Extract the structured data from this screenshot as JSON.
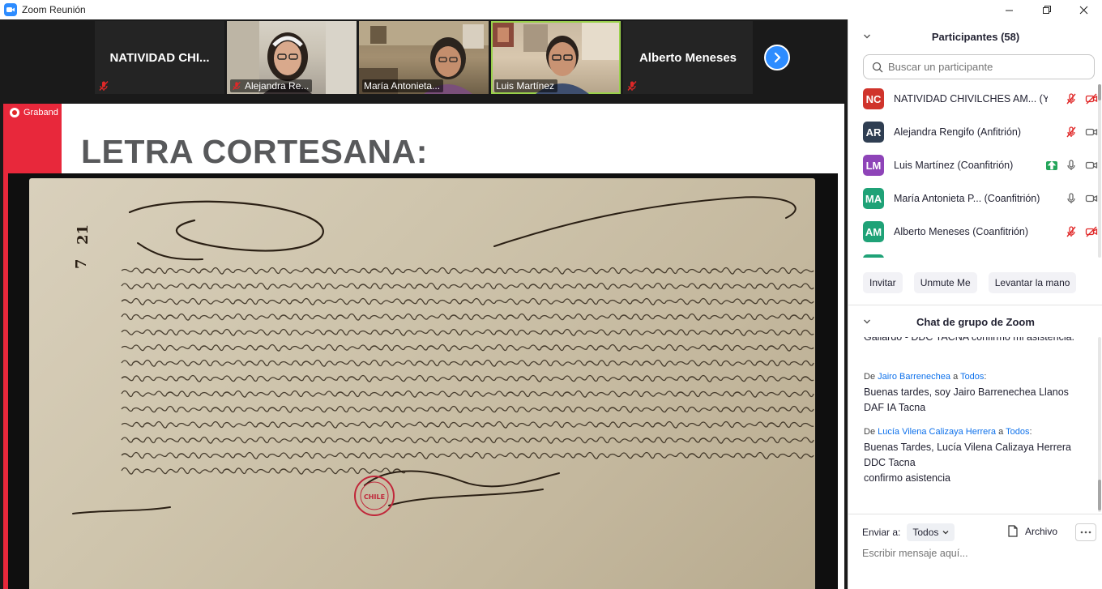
{
  "window": {
    "title": "Zoom Reunión",
    "icon": "zoom-camera-icon",
    "controls": [
      "minimize-icon",
      "maximize-icon",
      "close-icon"
    ]
  },
  "gallery": {
    "tiles": [
      {
        "name": "NATIVIDAD CHI...",
        "muted": true,
        "video": false
      },
      {
        "name": "Alejandra Re...",
        "muted": true,
        "video": true
      },
      {
        "name": "María Antonieta...",
        "muted": false,
        "video": true
      },
      {
        "name": "Luis Martínez",
        "muted": false,
        "video": true,
        "active": true
      },
      {
        "name": "Alberto Meneses",
        "muted": true,
        "video": false
      }
    ],
    "next_icon": "chevron-right-icon"
  },
  "share": {
    "recording_label": "Graband",
    "slide_title": "LETRA CORTESANA:",
    "document_numbers": [
      "7",
      "21"
    ],
    "stamp_text": "CHILE"
  },
  "participants": {
    "header": "Participantes (58)",
    "search_placeholder": "Buscar un participante",
    "list": [
      {
        "initials": "NC",
        "name": "NATIVIDAD CHIVILCHES AM... (Yo)",
        "color": "#d0342c",
        "mic": "muted",
        "video": "off"
      },
      {
        "initials": "AR",
        "name": "Alejandra Rengifo (Anfitrión)",
        "color": "#2f3e52",
        "mic": "muted",
        "video": "on"
      },
      {
        "initials": "LM",
        "name": "Luis Martínez (Coanfitrión)",
        "color": "#8e44b8",
        "mic": "on",
        "video": "on",
        "sharing": true
      },
      {
        "initials": "MA",
        "name": "María Antonieta P...  (Coanfitrión)",
        "color": "#1fa277",
        "mic": "on",
        "video": "on"
      },
      {
        "initials": "AM",
        "name": "Alberto Meneses (Coanfitrión)",
        "color": "#1fa277",
        "mic": "muted",
        "video": "off"
      },
      {
        "initials": "",
        "name": "",
        "color": "#1fa277",
        "mic": "muted",
        "video": "off"
      }
    ],
    "buttons": [
      "Invitar",
      "Unmute Me",
      "Levantar la mano"
    ]
  },
  "chat": {
    "header": "Chat de grupo de Zoom",
    "messages": [
      {
        "from": "",
        "to": "",
        "text": "Gallardo - DDC TACNA confirmo mi asistencia."
      },
      {
        "from": "Jairo Barrenechea",
        "to": "Todos",
        "connector": "a",
        "prefix": "De",
        "text": "Buenas tardes, soy Jairo Barrenechea Llanos DAF IA Tacna"
      },
      {
        "from": "Lucía Vilena Calizaya Herrera",
        "to": "Todos",
        "connector": "a",
        "prefix": "De",
        "text": "Buenas Tardes, Lucía Vilena Calizaya Herrera DDC Tacna\nconfirmo asistencia"
      }
    ],
    "send_to_label": "Enviar a:",
    "send_to_value": "Todos",
    "file_label": "Archivo",
    "input_placeholder": "Escribir mensaje aquí..."
  },
  "colors": {
    "zoom_blue": "#2d8cff",
    "recording_red": "#e8283b",
    "muted_red": "#e02828",
    "link_blue": "#0e71eb",
    "active_border": "#9ad14b"
  }
}
